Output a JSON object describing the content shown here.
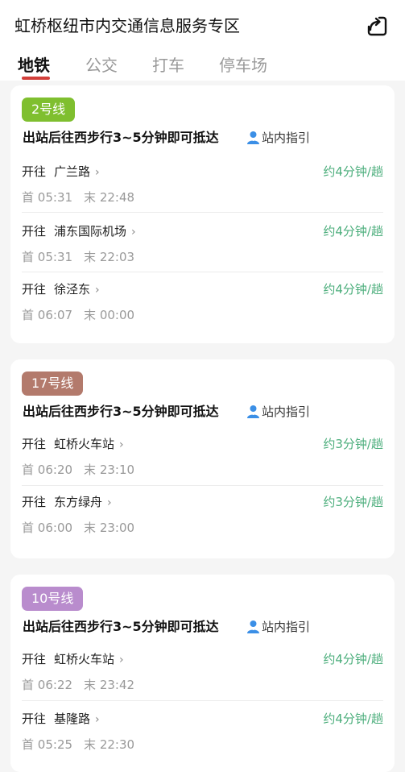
{
  "header": {
    "title": "虹桥枢纽市内交通信息服务专区",
    "share_icon": "share-icon"
  },
  "tabs": [
    {
      "label": "地铁",
      "active": true
    },
    {
      "label": "公交",
      "active": false
    },
    {
      "label": "打车",
      "active": false
    },
    {
      "label": "停车场",
      "active": false
    }
  ],
  "colors": {
    "accent": "#d23f3a",
    "freq_green": "#4cae7c",
    "line2": "#7fbf2f",
    "line17": "#b37a6c",
    "line10": "#b98ccd"
  },
  "cards": [
    {
      "line": "2号线",
      "exit_info": "出站后往西步行3~5分钟即可抵达",
      "guide_label": "站内指引",
      "rows": [
        {
          "prefix": "开往",
          "dest": "广兰路",
          "freq": "约4分钟/趟",
          "first_label": "首",
          "first": "05:31",
          "last_label": "末",
          "last": "22:48"
        },
        {
          "prefix": "开往",
          "dest": "浦东国际机场",
          "freq": "约4分钟/趟",
          "first_label": "首",
          "first": "05:31",
          "last_label": "末",
          "last": "22:03"
        },
        {
          "prefix": "开往",
          "dest": "徐泾东",
          "freq": "约4分钟/趟",
          "first_label": "首",
          "first": "06:07",
          "last_label": "末",
          "last": "00:00"
        }
      ]
    },
    {
      "line": "17号线",
      "exit_info": "出站后往西步行3~5分钟即可抵达",
      "guide_label": "站内指引",
      "rows": [
        {
          "prefix": "开往",
          "dest": "虹桥火车站",
          "freq": "约3分钟/趟",
          "first_label": "首",
          "first": "06:20",
          "last_label": "末",
          "last": "23:10"
        },
        {
          "prefix": "开往",
          "dest": "东方绿舟",
          "freq": "约3分钟/趟",
          "first_label": "首",
          "first": "06:00",
          "last_label": "末",
          "last": "23:00"
        }
      ]
    },
    {
      "line": "10号线",
      "exit_info": "出站后往西步行3~5分钟即可抵达",
      "guide_label": "站内指引",
      "rows": [
        {
          "prefix": "开往",
          "dest": "虹桥火车站",
          "freq": "约4分钟/趟",
          "first_label": "首",
          "first": "06:22",
          "last_label": "末",
          "last": "23:42"
        },
        {
          "prefix": "开往",
          "dest": "基隆路",
          "freq": "约4分钟/趟",
          "first_label": "首",
          "first": "05:25",
          "last_label": "末",
          "last": "22:30"
        }
      ]
    }
  ]
}
